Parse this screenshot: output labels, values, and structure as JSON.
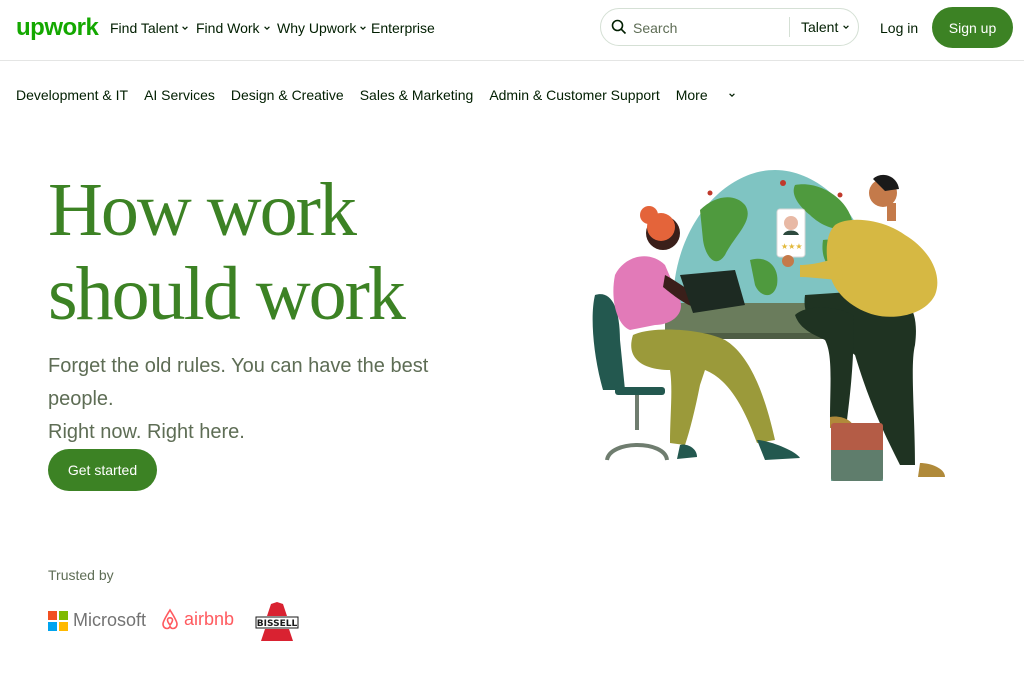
{
  "brand": {
    "logo_text": "upwork"
  },
  "header": {
    "nav": [
      {
        "label": "Find Talent",
        "has_dropdown": true
      },
      {
        "label": "Find Work",
        "has_dropdown": true
      },
      {
        "label": "Why Upwork",
        "has_dropdown": true
      },
      {
        "label": "Enterprise",
        "has_dropdown": false
      }
    ],
    "search": {
      "placeholder": "Search",
      "scope": "Talent"
    },
    "login_label": "Log in",
    "signup_label": "Sign up"
  },
  "categories": {
    "items": [
      "Development & IT",
      "AI Services",
      "Design & Creative",
      "Sales & Marketing",
      "Admin & Customer Support"
    ],
    "more_label": "More"
  },
  "hero": {
    "headline_line1": "How work",
    "headline_line2": "should work",
    "subtitle_line1": "Forget the old rules. You can have the best people.",
    "subtitle_line2": "Right now. Right here.",
    "cta_label": "Get started"
  },
  "trusted": {
    "label": "Trusted by",
    "logos": [
      "Microsoft",
      "airbnb",
      "BISSELL"
    ]
  },
  "colors": {
    "brand_green": "#14a800",
    "button_green": "#3c8224",
    "text_dark": "#001e00",
    "text_muted": "#5e6d55"
  },
  "icons": [
    "search-icon",
    "chevron-down-icon",
    "microsoft-logo",
    "airbnb-logo",
    "bissell-logo"
  ]
}
